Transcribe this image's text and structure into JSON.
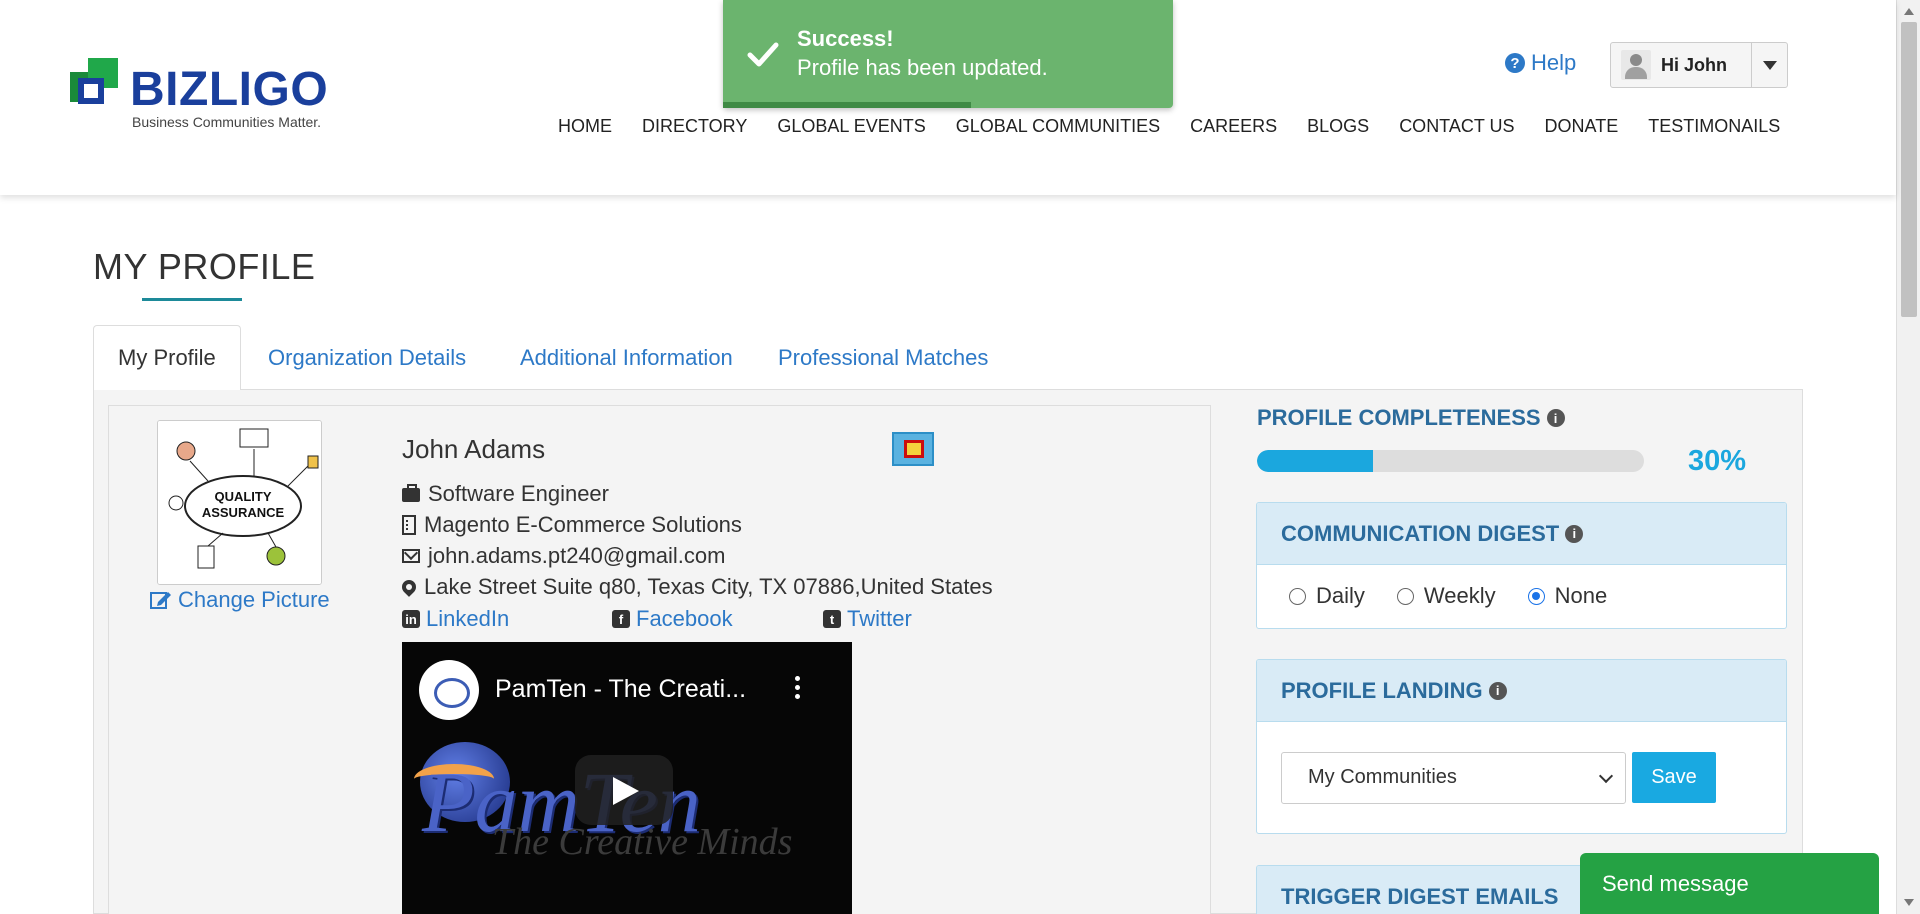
{
  "header": {
    "logo": {
      "word": "BIZLIGO",
      "tagline": "Business Communities Matter."
    },
    "help_label": "Help",
    "user_greeting": "Hi John",
    "nav": [
      {
        "label": "HOME"
      },
      {
        "label": "DIRECTORY"
      },
      {
        "label": "GLOBAL EVENTS"
      },
      {
        "label": "GLOBAL COMMUNITIES"
      },
      {
        "label": "CAREERS"
      },
      {
        "label": "BLOGS"
      },
      {
        "label": "CONTACT US"
      },
      {
        "label": "DONATE"
      },
      {
        "label": "TESTIMONAILS"
      }
    ]
  },
  "toast": {
    "title": "Success!",
    "message": "Profile has been updated.",
    "remaining_fraction": 0.55,
    "color": "#6bb46e"
  },
  "page": {
    "title": "MY PROFILE",
    "tabs": [
      {
        "label": "My Profile",
        "active": true
      },
      {
        "label": "Organization Details"
      },
      {
        "label": "Additional Information"
      },
      {
        "label": "Professional Matches"
      }
    ]
  },
  "profile": {
    "avatar_icon": "quality-assurance-image",
    "change_picture_label": "Change Picture",
    "name": "John Adams",
    "job_title": "Software Engineer",
    "company": "Magento E-Commerce Solutions",
    "email": "john.adams.pt240@gmail.com",
    "address": "Lake Street Suite q80, Texas City, TX 07886,United States",
    "social": {
      "linkedin": "LinkedIn",
      "facebook": "Facebook",
      "twitter": "Twitter"
    },
    "video": {
      "title": "PamTen - The Creati...",
      "brand": "PamTen",
      "tagline": "The Creative Minds"
    }
  },
  "sidebar": {
    "completeness": {
      "title": "PROFILE COMPLETENESS",
      "percent_label": "30%",
      "percent": 30
    },
    "digest": {
      "title": "COMMUNICATION DIGEST",
      "options": [
        {
          "label": "Daily",
          "checked": false
        },
        {
          "label": "Weekly",
          "checked": false
        },
        {
          "label": "None",
          "checked": true
        }
      ]
    },
    "landing": {
      "title": "PROFILE LANDING",
      "selected": "My Communities",
      "save_label": "Save"
    },
    "trigger": {
      "title": "TRIGGER DIGEST EMAILS"
    }
  },
  "chat": {
    "label": "Send message"
  }
}
